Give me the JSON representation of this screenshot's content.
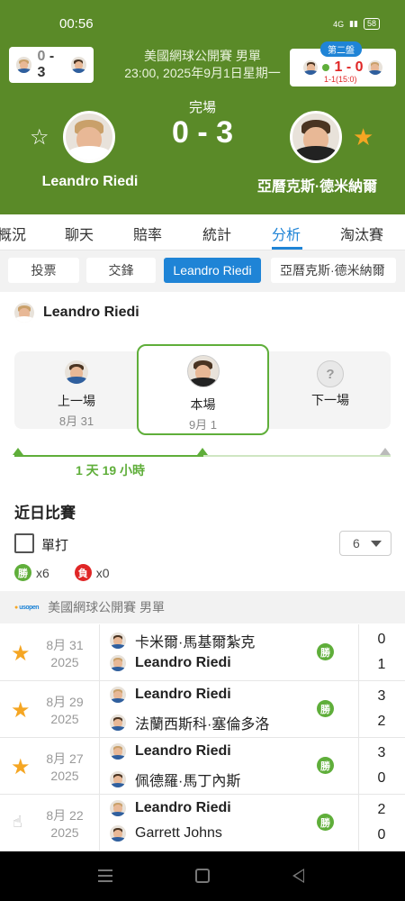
{
  "status_bar": {
    "time": "00:56",
    "signal": "4G",
    "battery": "58"
  },
  "header": {
    "left_mini_score": {
      "home": "0",
      "sep": "-",
      "away": "3"
    },
    "right_mini": {
      "set_label": "第二盤",
      "home": "1",
      "away": "0",
      "sub": "1-1(15:0)"
    },
    "tournament": "美國網球公開賽 男單",
    "datetime": "23:00, 2025年9月1日星期一",
    "status": "完場",
    "score": "0 - 3",
    "home_player": "Leandro Riedi",
    "away_player": "亞曆克斯·德米納爾"
  },
  "tabs": [
    "概況",
    "聊天",
    "賠率",
    "統計",
    "分析",
    "淘汰賽"
  ],
  "active_tab": "分析",
  "subtabs": [
    "投票",
    "交鋒",
    "Leandro Riedi",
    "亞曆克斯·德米納爾"
  ],
  "active_subtab": "Leandro Riedi",
  "focus_player": "Leandro Riedi",
  "timeline": {
    "prev": {
      "label": "上一場",
      "date": "8月 31"
    },
    "current": {
      "label": "本場",
      "date": "9月 1"
    },
    "next": {
      "label": "下一場",
      "placeholder": "?"
    },
    "elapsed": "1 天 19 小時"
  },
  "recent": {
    "title": "近日比賽",
    "singles_label": "單打",
    "count_value": "6",
    "win_badge": "勝",
    "loss_badge": "負",
    "wins": "x6",
    "losses": "x0",
    "league": "美國網球公開賽 男單",
    "league_logo": "usopen",
    "matches": [
      {
        "date": "8月 31",
        "year": "2025",
        "p1": "卡米爾·馬基爾紮克",
        "p2": "Leandro Riedi",
        "s1": "0",
        "s2": "1",
        "result": "勝",
        "icon": "star-icon"
      },
      {
        "date": "8月 29",
        "year": "2025",
        "p1": "Leandro Riedi",
        "p2": "法蘭西斯科·塞倫多洛",
        "s1": "3",
        "s2": "2",
        "result": "勝",
        "icon": "star-icon"
      },
      {
        "date": "8月 27",
        "year": "2025",
        "p1": "Leandro Riedi",
        "p2": "佩德羅·馬丁內斯",
        "s1": "3",
        "s2": "0",
        "result": "勝",
        "icon": "star-icon"
      },
      {
        "date": "8月 22",
        "year": "2025",
        "p1": "Leandro Riedi",
        "p2": "Garrett Johns",
        "s1": "2",
        "s2": "0",
        "result": "勝",
        "icon": "hand-icon"
      }
    ]
  },
  "colors": {
    "header_bg": "#5a8a28",
    "accent": "#1f84d6",
    "win": "#5fae3a",
    "loss": "#e02626",
    "star": "#f5a623"
  }
}
